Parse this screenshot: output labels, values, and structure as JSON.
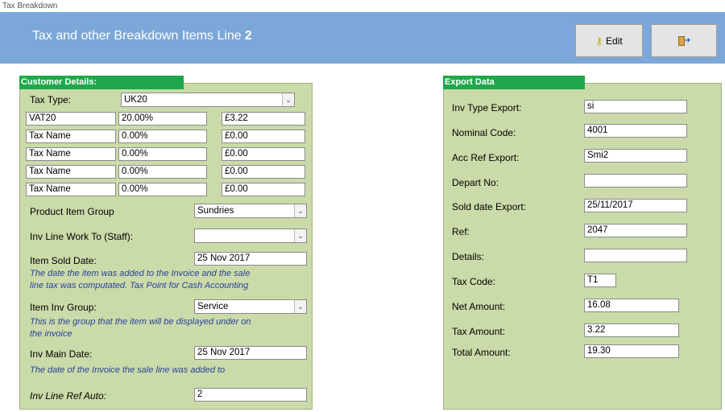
{
  "window": {
    "title": "Tax Breakdown"
  },
  "header": {
    "title": "Tax and other Breakdown Items Line",
    "line_number": "2"
  },
  "toolbar": {
    "edit_label": "Edit",
    "edit_icon": "key-icon",
    "exit_icon": "exit-door-icon"
  },
  "customer": {
    "section_label": "Customer Details:",
    "tax_type_label": "Tax Type:",
    "tax_type_value": "UK20",
    "tax_rows": [
      {
        "name": "VAT20",
        "rate": "20.00%",
        "amount": "£3.22"
      },
      {
        "name": "Tax Name",
        "rate": "0.00%",
        "amount": "£0.00"
      },
      {
        "name": "Tax Name",
        "rate": "0.00%",
        "amount": "£0.00"
      },
      {
        "name": "Tax Name",
        "rate": "0.00%",
        "amount": "£0.00"
      },
      {
        "name": "Tax Name",
        "rate": "0.00%",
        "amount": "£0.00"
      }
    ],
    "product_group_label": "Product Item Group",
    "product_group_value": "Sundries",
    "work_to_label": "Inv Line Work To (Staff):",
    "work_to_value": "",
    "sold_date_label": "Item Sold Date:",
    "sold_date_value": "25 Nov 2017",
    "sold_date_note_1": "The date the item was added to the Invoice  and the sale",
    "sold_date_note_2": "line tax was computated. Tax Point for Cash Accounting",
    "inv_group_label": "Item Inv Group:",
    "inv_group_value": "Service",
    "inv_group_note_1": "This is the group that the item will be displayed under on",
    "inv_group_note_2": "the invoice",
    "main_date_label": "Inv Main Date:",
    "main_date_value": "25 Nov 2017",
    "main_date_note": "The date of the Invoice the sale line was added to",
    "ref_auto_label": "Inv Line Ref Auto:",
    "ref_auto_value": "2"
  },
  "export": {
    "section_label": "Export Data",
    "inv_type_label": "Inv Type Export:",
    "inv_type_value": "si",
    "nominal_label": "Nominal Code:",
    "nominal_value": "4001",
    "acc_ref_label": "Acc Ref Export:",
    "acc_ref_value": "Smi2",
    "depart_label": "Depart No:",
    "depart_value": "",
    "sold_date_label": "Sold date Export:",
    "sold_date_value": "25/11/2017",
    "ref_label": "Ref:",
    "ref_value": "2047",
    "details_label": "Details:",
    "details_value": "",
    "tax_code_label": "Tax Code:",
    "tax_code_value": "T1",
    "net_label": "Net Amount:",
    "net_value": "16.08",
    "tax_label": "Tax Amount:",
    "tax_value": "3.22",
    "total_label": "Total Amount:",
    "total_value": "19.30"
  }
}
